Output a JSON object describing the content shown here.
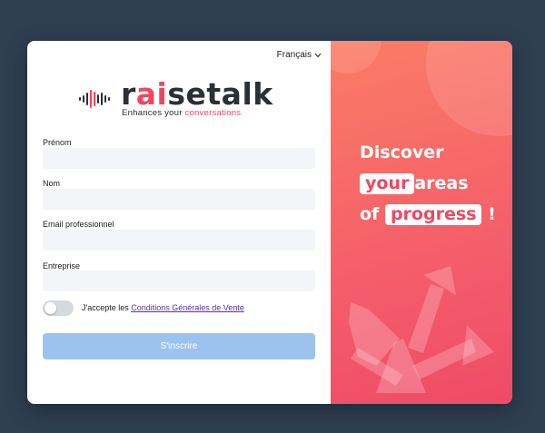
{
  "language": {
    "label": "Français"
  },
  "logo": {
    "word_start": "r",
    "word_accent": "ai",
    "word_end": "setalk",
    "tagline_start": "Enhances your ",
    "tagline_accent": "conversations"
  },
  "form": {
    "first_name": {
      "label": "Prénom",
      "value": "",
      "placeholder": ""
    },
    "last_name": {
      "label": "Nom",
      "value": "",
      "placeholder": ""
    },
    "email": {
      "label": "Email professionnel",
      "value": "",
      "placeholder": ""
    },
    "company": {
      "label": "Entreprise",
      "value": "",
      "placeholder": ""
    },
    "terms": {
      "prefix": "J'accepte les ",
      "link": "Conditions Générales de Vente",
      "checked": false
    },
    "submit_label": "S'inscrire"
  },
  "promo": {
    "line1": "Discover",
    "line2_highlight": "your",
    "line2_rest": "areas",
    "line3_start": "of",
    "line3_highlight": "progress",
    "line3_end": "!"
  },
  "colors": {
    "brand_accent": "#f0475f",
    "button_disabled": "#9cc3ee",
    "gradient_start": "#fb7c66",
    "gradient_end": "#ef4a68",
    "background": "#2f3f52"
  },
  "icons": [
    "chevron-down-icon",
    "sound-wave-icon",
    "arrows-icon"
  ]
}
